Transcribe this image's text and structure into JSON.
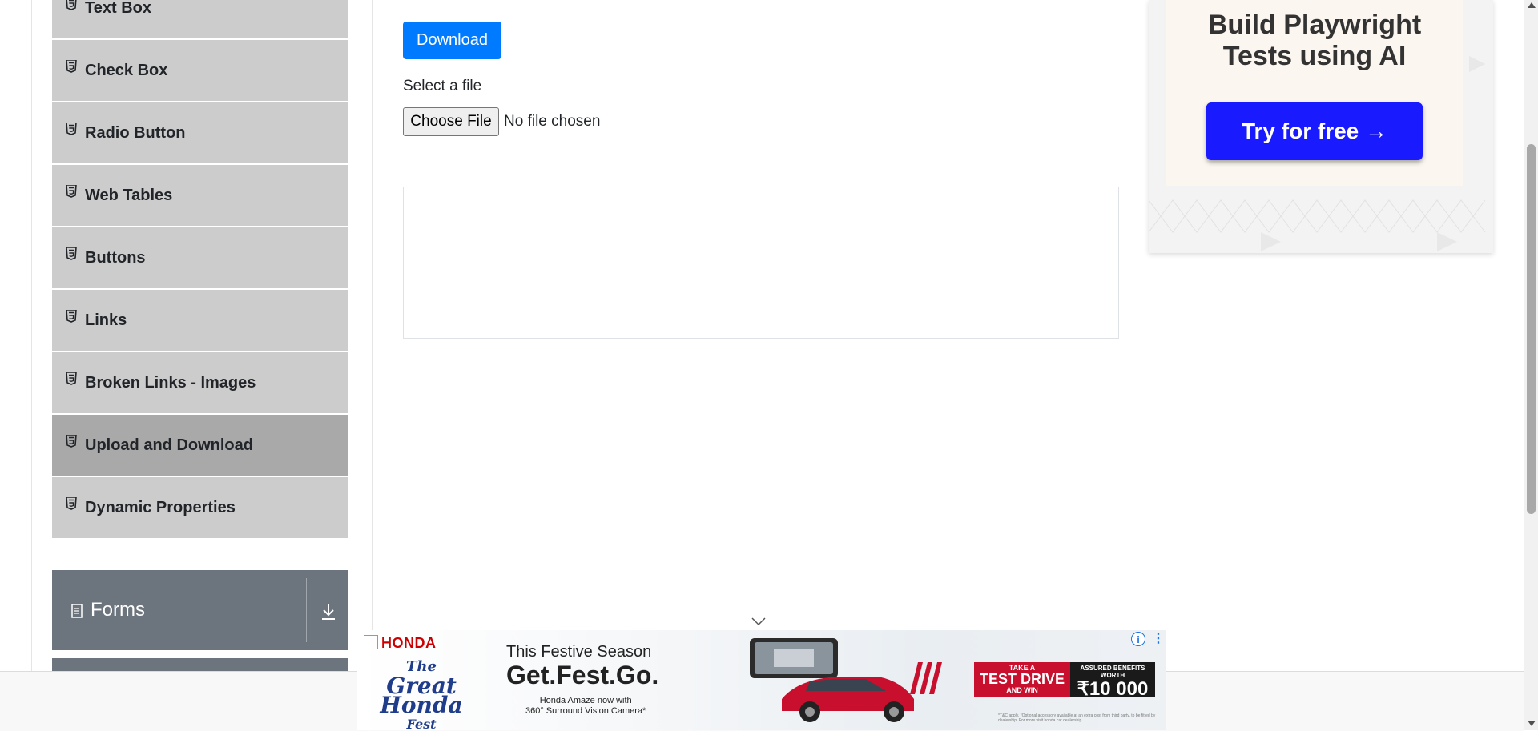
{
  "sidebar": {
    "items": [
      {
        "label": "Text Box",
        "active": false
      },
      {
        "label": "Check Box",
        "active": false
      },
      {
        "label": "Radio Button",
        "active": false
      },
      {
        "label": "Web Tables",
        "active": false
      },
      {
        "label": "Buttons",
        "active": false
      },
      {
        "label": "Links",
        "active": false
      },
      {
        "label": "Broken Links - Images",
        "active": false
      },
      {
        "label": "Upload and Download",
        "active": true
      },
      {
        "label": "Dynamic Properties",
        "active": false
      }
    ],
    "group": {
      "label": "Forms"
    }
  },
  "main": {
    "download_label": "Download",
    "select_label": "Select a file",
    "choose_file_label": "Choose File",
    "no_file_text": "No file chosen"
  },
  "ad_right": {
    "headline_line1": "Build Playwright",
    "headline_line2": "Tests using AI",
    "button_label": "Try for free →"
  },
  "ad_bottom": {
    "brand": "HONDA",
    "fest_line1": "The",
    "fest_line2": "Great Honda",
    "fest_line3": "Fest",
    "tagline": "This Festive Season",
    "headline": "Get.Fest.Go.",
    "sub1": "Honda Amaze now with",
    "sub2": "360° Surround Vision Camera*",
    "test_small": "TAKE A",
    "test_big": "TEST DRIVE",
    "test_win": "AND WIN",
    "benefit_small": "ASSURED BENEFITS WORTH",
    "benefit_value": "₹10 000",
    "disclaimer": "*T&C apply. *Optional accessory available at an extra cost from third party, to be fitted by dealership. For more visit honda car dealership."
  },
  "colors": {
    "primary_button": "#007bff",
    "sidebar_item": "#cccccc",
    "sidebar_active": "#a9a9a9",
    "group_header": "#6c757d",
    "ad_button": "#1a1aff",
    "honda_red": "#cc0000"
  }
}
